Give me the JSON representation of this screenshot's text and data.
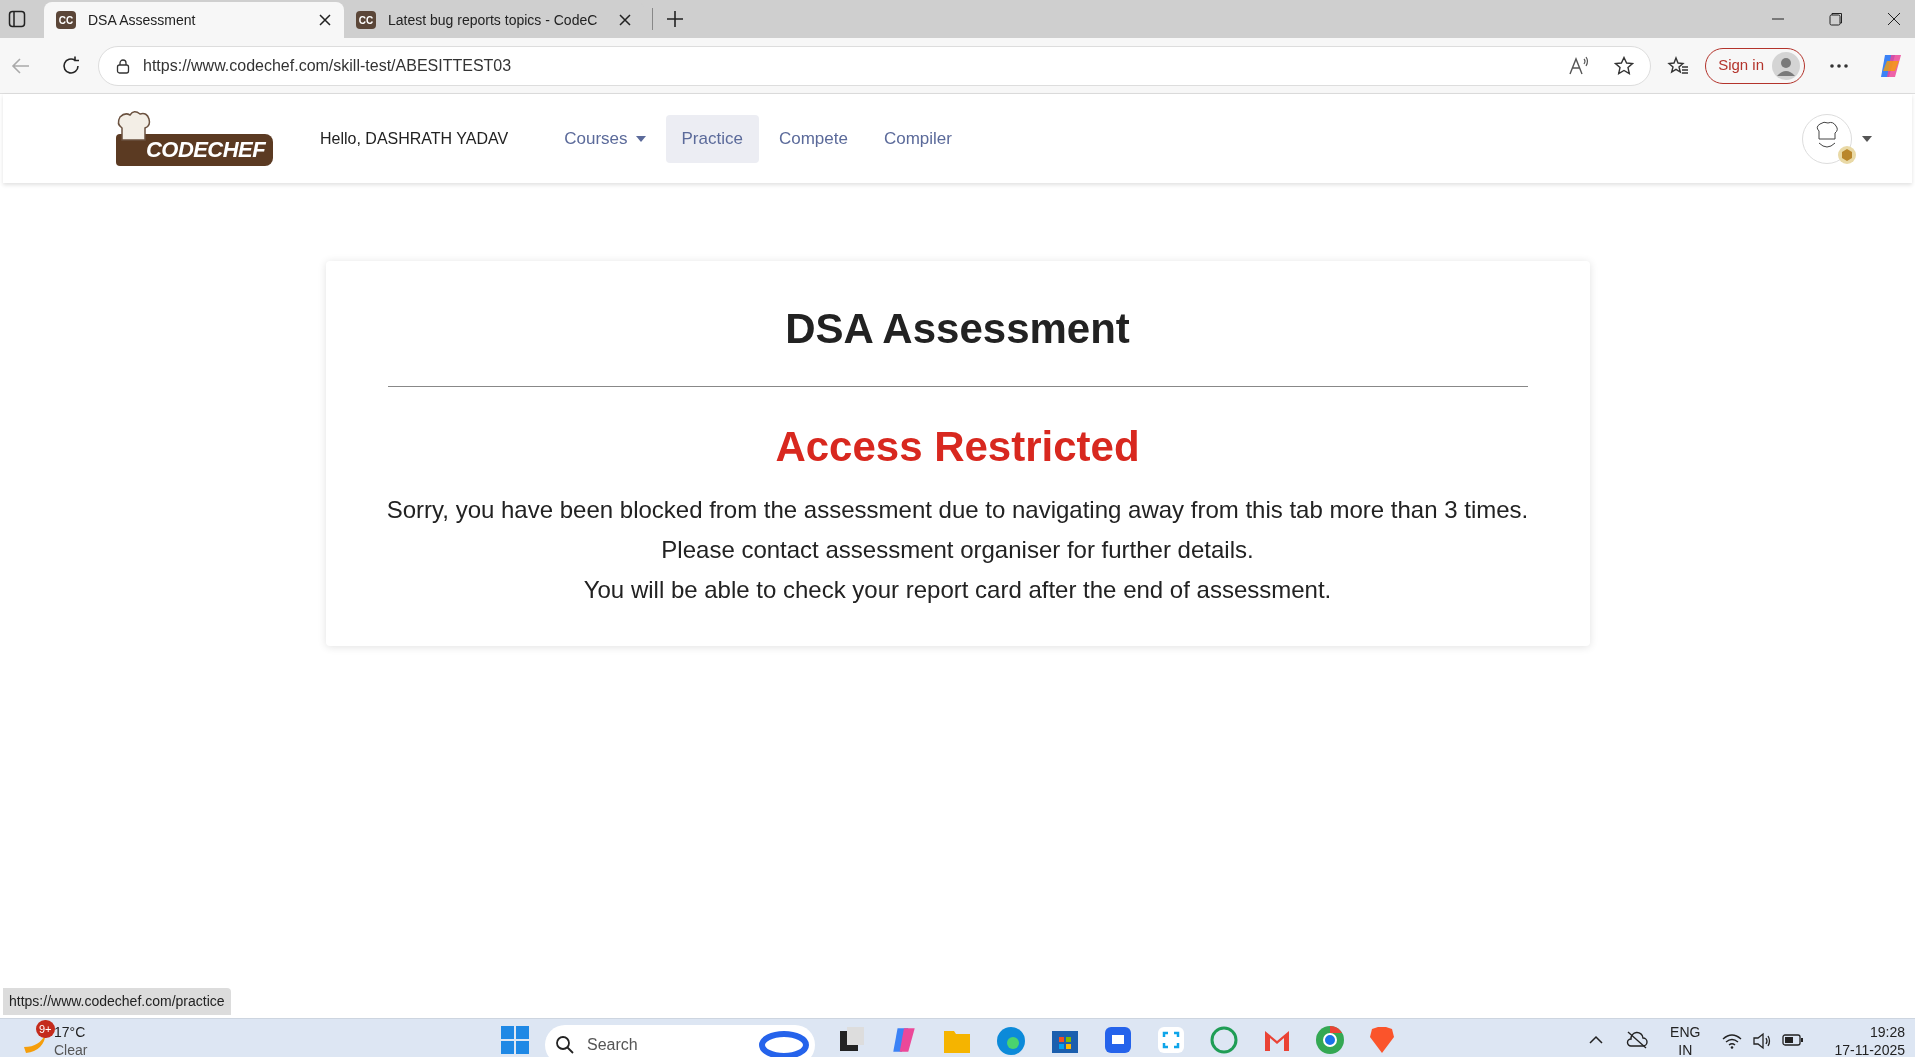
{
  "browser": {
    "tabs": [
      {
        "favicon": "CC",
        "title": "DSA Assessment",
        "selected": true
      },
      {
        "favicon": "CC",
        "title": "Latest bug reports topics - CodeC",
        "selected": false
      }
    ],
    "url": "https://www.codechef.com/skill-test/ABESITTEST03",
    "sign_in": "Sign in"
  },
  "site_nav": {
    "logo": "CODECHEF",
    "greeting": "Hello, DASHRATH YADAV",
    "links": [
      {
        "label": "Courses",
        "dropdown": true,
        "selected": false
      },
      {
        "label": "Practice",
        "dropdown": false,
        "selected": true
      },
      {
        "label": "Compete",
        "dropdown": false,
        "selected": false
      },
      {
        "label": "Compiler",
        "dropdown": false,
        "selected": false
      }
    ]
  },
  "card": {
    "title": "DSA Assessment",
    "status": "Access Restricted",
    "lines": [
      "Sorry, you have been blocked from the assessment due to navigating away from this tab more than 3 times.",
      "Please contact assessment organiser for further details.",
      "You will be able to check your report card after the end of assessment."
    ]
  },
  "status_link": "https://www.codechef.com/practice",
  "taskbar": {
    "weather_badge": "9+",
    "temperature": "17°C",
    "condition": "Clear",
    "search": "Search",
    "language": "ENG",
    "region": "IN",
    "time": "19:28",
    "date": "17-11-2025"
  }
}
